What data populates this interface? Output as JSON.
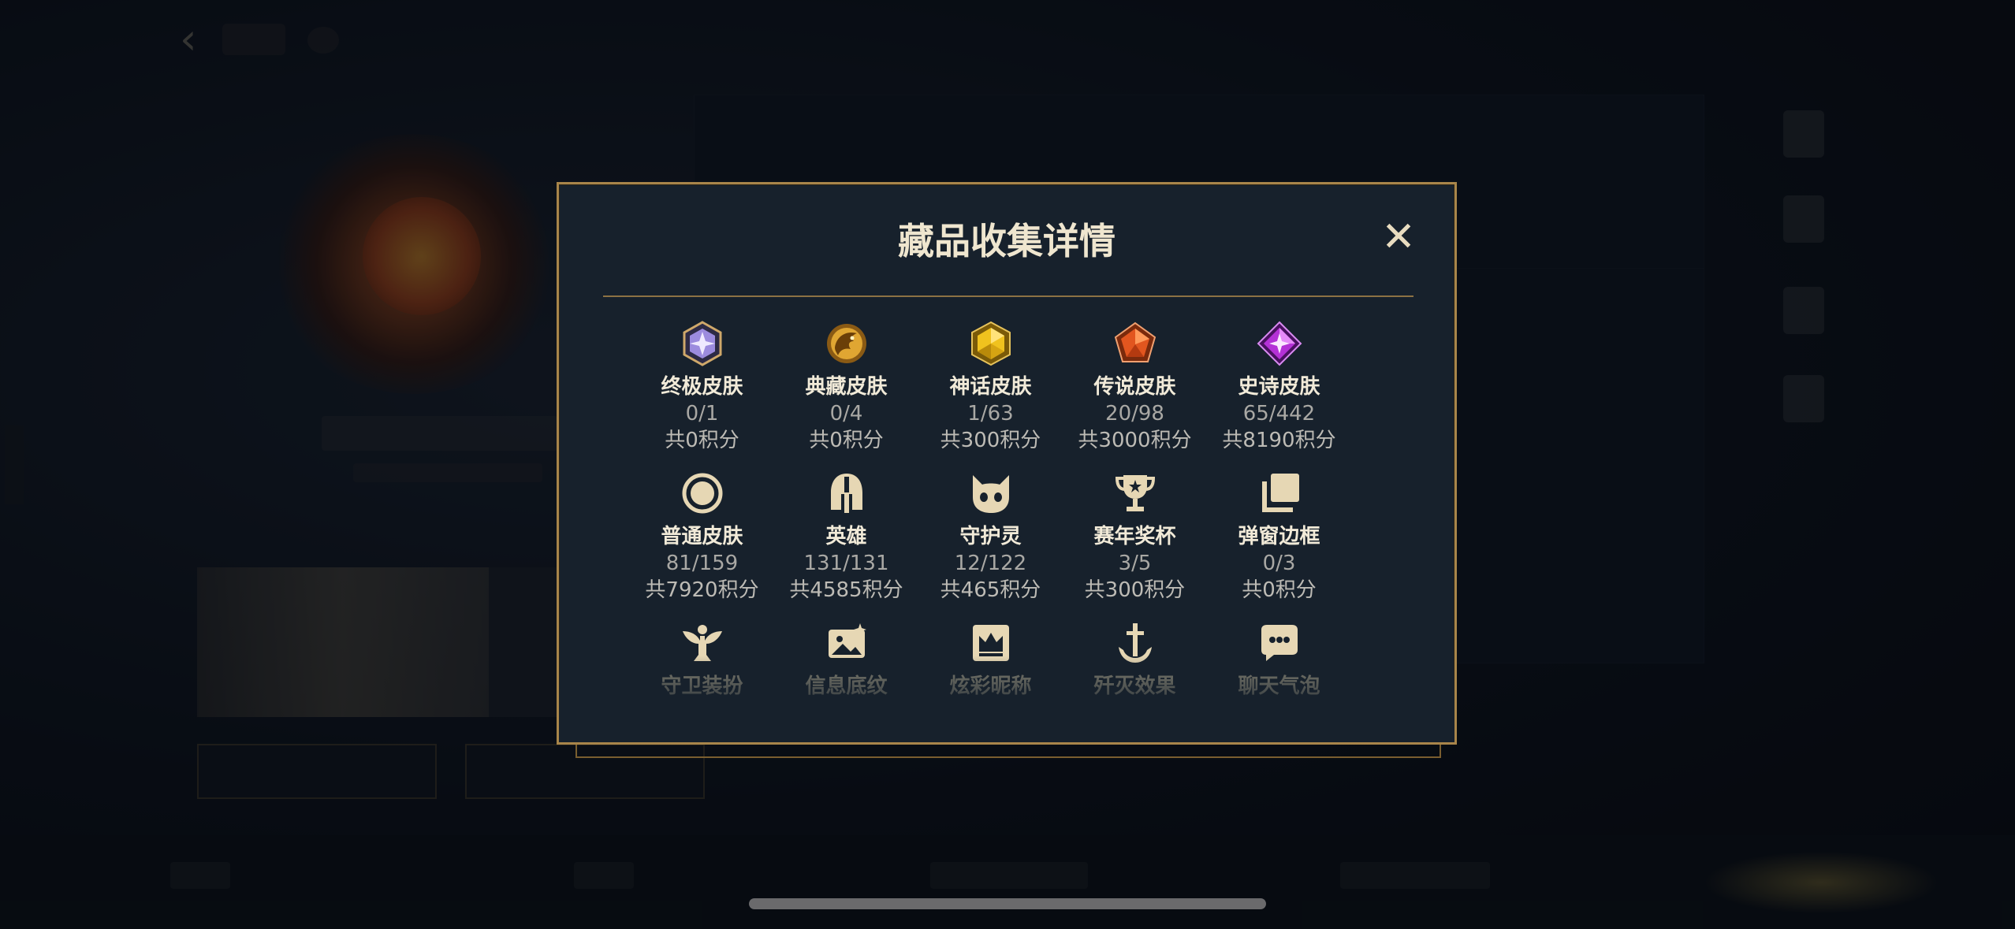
{
  "modal": {
    "title": "藏品收集详情",
    "close_symbol": "✕"
  },
  "categories": [
    {
      "label": "终极皮肤",
      "count": "0/1",
      "points": "共0积分",
      "icon": "ultimate-gem-icon",
      "color": "#b9a6ee"
    },
    {
      "label": "典藏皮肤",
      "count": "0/4",
      "points": "共0积分",
      "icon": "dragon-emblem-icon",
      "color": "#d79a2c"
    },
    {
      "label": "神话皮肤",
      "count": "1/63",
      "points": "共300积分",
      "icon": "mythic-gem-icon",
      "color": "#e2b21c"
    },
    {
      "label": "传说皮肤",
      "count": "20/98",
      "points": "共3000积分",
      "icon": "legend-gem-icon",
      "color": "#e2561f"
    },
    {
      "label": "史诗皮肤",
      "count": "65/442",
      "points": "共8190积分",
      "icon": "epic-gem-icon",
      "color": "#b431d6"
    },
    {
      "label": "普通皮肤",
      "count": "81/159",
      "points": "共7920积分",
      "icon": "circle-icon",
      "color": "#e6d7b4"
    },
    {
      "label": "英雄",
      "count": "131/131",
      "points": "共4585积分",
      "icon": "helmet-icon",
      "color": "#e6d7b4"
    },
    {
      "label": "守护灵",
      "count": "12/122",
      "points": "共465积分",
      "icon": "guardian-creature-icon",
      "color": "#e6d7b4"
    },
    {
      "label": "赛年奖杯",
      "count": "3/5",
      "points": "共300积分",
      "icon": "trophy-icon",
      "color": "#e6d7b4"
    },
    {
      "label": "弹窗边框",
      "count": "0/3",
      "points": "共0积分",
      "icon": "stacked-frames-icon",
      "color": "#e6d7b4"
    },
    {
      "label": "守卫装扮",
      "icon": "ward-icon",
      "color": "#e6d7b4"
    },
    {
      "label": "信息底纹",
      "icon": "image-sparkle-icon",
      "color": "#e6d7b4"
    },
    {
      "label": "炫彩昵称",
      "icon": "crown-card-icon",
      "color": "#e6d7b4"
    },
    {
      "label": "歼灭效果",
      "icon": "sword-anchor-icon",
      "color": "#e6d7b4"
    },
    {
      "label": "聊天气泡",
      "icon": "chat-bubble-icon",
      "color": "#e6d7b4"
    }
  ],
  "theme": {
    "accent_gold": "#a8854a",
    "modal_bg": "#17212c"
  }
}
